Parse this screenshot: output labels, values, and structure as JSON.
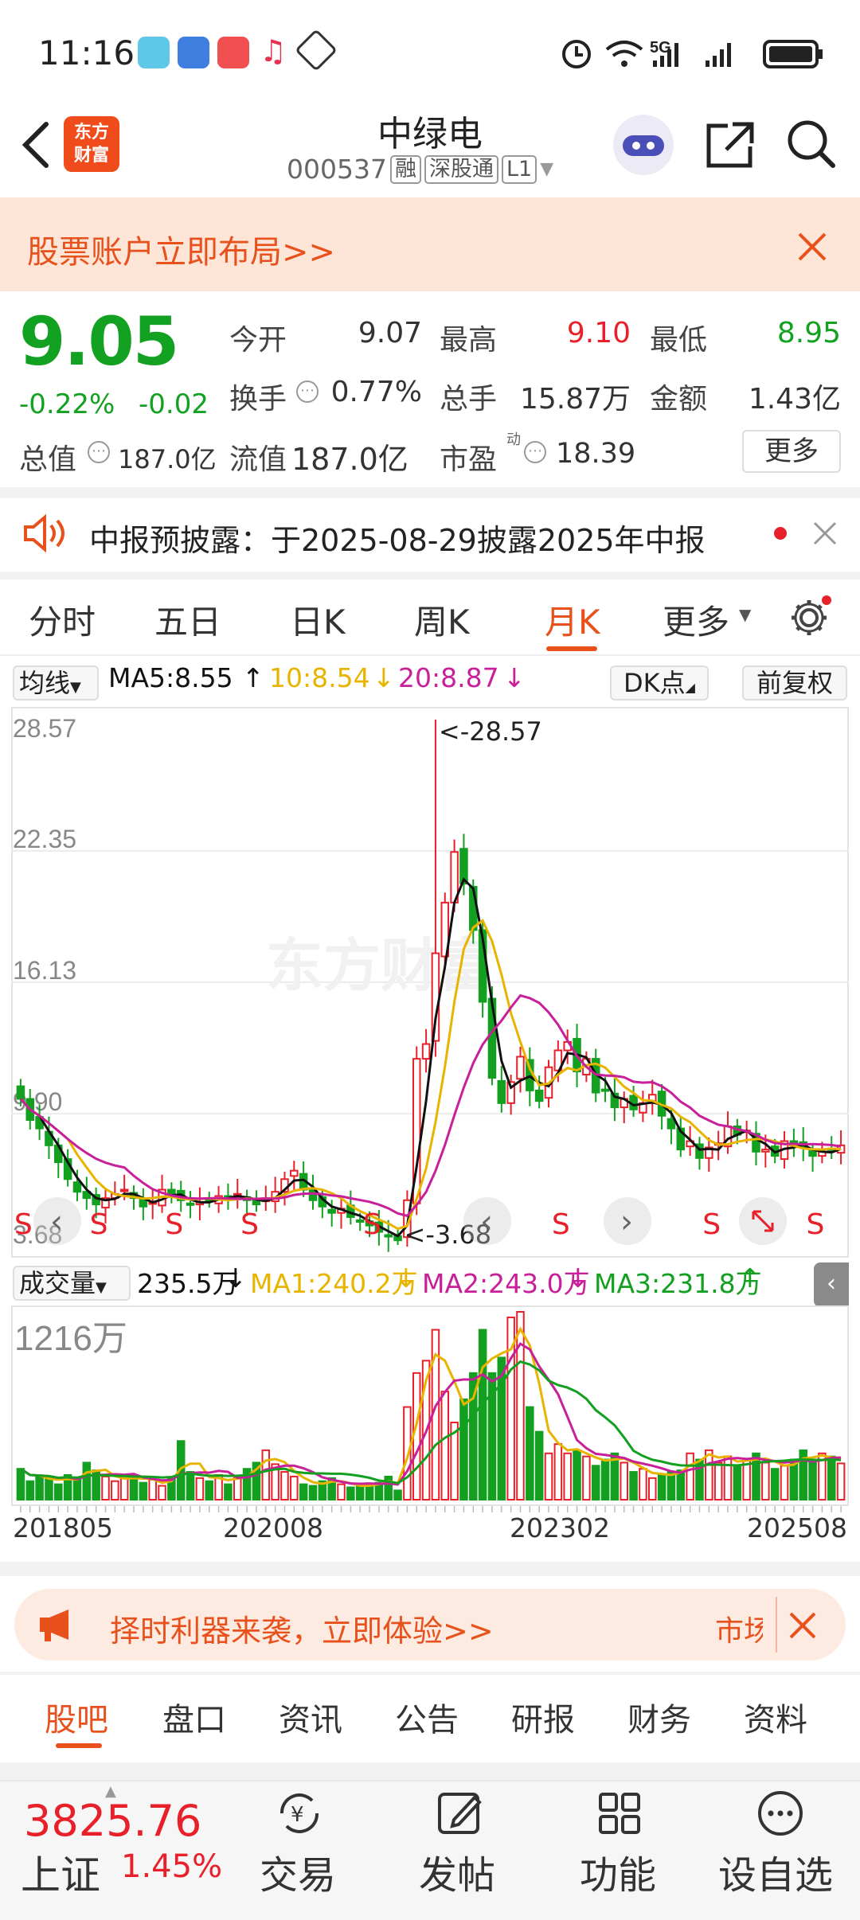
{
  "status": {
    "time": "11:16",
    "network": "5G"
  },
  "header": {
    "logo_line1": "东方",
    "logo_line2": "财富",
    "name": "中绿电",
    "code": "000537",
    "tags": [
      "融",
      "深股通",
      "L1"
    ]
  },
  "top_banner": {
    "text": "股票账户立即布局>>"
  },
  "quote": {
    "price": "9.05",
    "change_pct": "-0.22%",
    "change": "-0.02",
    "open_label": "今开",
    "open": "9.07",
    "high_label": "最高",
    "high": "9.10",
    "low_label": "最低",
    "low": "8.95",
    "turnover_label": "换手",
    "turnover": "0.77%",
    "volume_label": "总手",
    "volume": "15.87万",
    "amount_label": "金额",
    "amount": "1.43亿",
    "mcap_label": "总值",
    "mcap": "187.0亿",
    "float_label": "流值",
    "float": "187.0亿",
    "pe_label": "市盈",
    "pe_sup": "动",
    "pe": "18.39",
    "more": "更多"
  },
  "notice": {
    "text": "中报预披露：于2025-08-29披露2025年中报"
  },
  "tabs": [
    "分时",
    "五日",
    "日K",
    "周K",
    "月K",
    "更多"
  ],
  "active_tab": "月K",
  "ma_bar": {
    "type": "均线",
    "ma5": "MA5:8.55",
    "ma10": "10:8.54",
    "ma20": "20:8.87",
    "dk": "DK点",
    "adjust": "前复权"
  },
  "chart_data": {
    "type": "candlestick",
    "y_ticks": [
      "28.57",
      "22.35",
      "16.13",
      "9.90",
      "3.68"
    ],
    "ylim": [
      3.68,
      28.57
    ],
    "max_label": "<-28.57",
    "min_label": "<-3.68",
    "signal_label": "S",
    "colors": {
      "up": "#e8202a",
      "down": "#13a020",
      "ma5": "#111111",
      "ma10": "#e8b400",
      "ma20": "#c8209a"
    },
    "months": 88,
    "close": [
      10.6,
      9.6,
      9.2,
      8.4,
      7.6,
      6.8,
      6.2,
      5.9,
      5.6,
      5.9,
      6.1,
      6.3,
      5.9,
      5.5,
      5.7,
      6.3,
      6.1,
      5.8,
      5.6,
      5.7,
      5.8,
      6.0,
      5.9,
      6.1,
      5.8,
      5.6,
      5.9,
      6.2,
      6.8,
      7.2,
      6.3,
      5.8,
      5.5,
      5.2,
      5.4,
      5.0,
      4.8,
      4.6,
      4.3,
      4.1,
      3.9,
      5.8,
      12.5,
      13.2,
      17.5,
      19.9,
      22.3,
      20.8,
      18.6,
      15.2,
      11.6,
      10.4,
      11.4,
      12.6,
      11.0,
      10.5,
      12.1,
      12.9,
      13.3,
      11.9,
      12.5,
      10.9,
      11.0,
      10.2,
      10.6,
      10.1,
      10.4,
      10.8,
      9.8,
      9.2,
      8.2,
      8.6,
      7.8,
      8.3,
      8.5,
      9.3,
      8.9,
      9.1,
      8.1,
      8.2,
      7.9,
      8.6,
      8.4,
      8.3,
      7.9,
      8.1,
      8.2,
      8.4
    ],
    "volume_ma_labels": {
      "vol": "成交量",
      "v": "235.5万",
      "ma1": "MA1:240.2万",
      "ma2": "MA2:243.0万",
      "ma3": "MA3:231.8万"
    },
    "volume_max_label": "1216万",
    "volume": [
      200,
      120,
      150,
      140,
      100,
      160,
      130,
      240,
      190,
      150,
      120,
      140,
      160,
      110,
      130,
      90,
      140,
      380,
      180,
      140,
      120,
      160,
      100,
      150,
      200,
      240,
      320,
      230,
      180,
      150,
      100,
      90,
      120,
      140,
      100,
      80,
      90,
      100,
      110,
      150,
      60,
      600,
      820,
      900,
      1100,
      700,
      500,
      650,
      820,
      1100,
      820,
      920,
      1180,
      1216,
      600,
      440,
      300,
      360,
      300,
      320,
      280,
      220,
      260,
      300,
      240,
      180,
      200,
      140,
      160,
      180,
      190,
      300,
      260,
      320,
      240,
      280,
      220,
      260,
      300,
      240,
      200,
      220,
      260,
      320,
      240,
      300,
      280,
      235
    ],
    "x_ticks": [
      "201805",
      "202008",
      "202302",
      "202508"
    ]
  },
  "banner2": {
    "text": "择时利器来袭，立即体验>>",
    "tail": "市场"
  },
  "tabs2": [
    "股吧",
    "盘口",
    "资讯",
    "公告",
    "研报",
    "财务",
    "资料"
  ],
  "active_tab2": "股吧",
  "bottom": {
    "index_value": "3825.76",
    "index_name": "上证",
    "index_pct": "1.45%",
    "trade": "交易",
    "post": "发帖",
    "func": "功能",
    "watch": "设自选"
  }
}
